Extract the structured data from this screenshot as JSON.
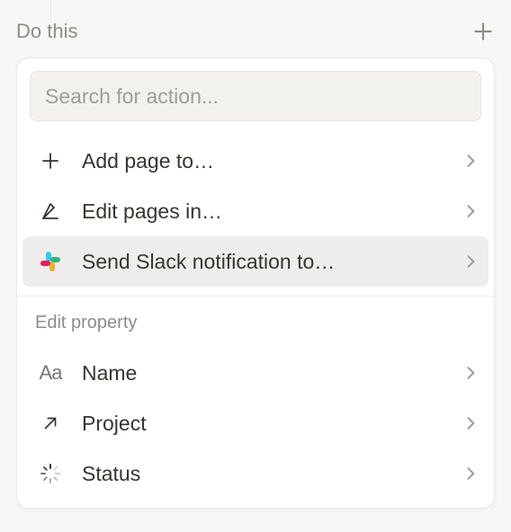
{
  "header": {
    "label": "Do this"
  },
  "search": {
    "placeholder": "Search for action..."
  },
  "actions": [
    {
      "label": "Add page to…",
      "icon": "plus"
    },
    {
      "label": "Edit pages in…",
      "icon": "edit-line"
    },
    {
      "label": "Send Slack notification to…",
      "icon": "slack",
      "highlight": true
    }
  ],
  "sectionLabel": "Edit property",
  "properties": [
    {
      "label": "Name",
      "icon": "text-aa"
    },
    {
      "label": "Project",
      "icon": "arrow-up-right"
    },
    {
      "label": "Status",
      "icon": "loading-dots"
    }
  ]
}
